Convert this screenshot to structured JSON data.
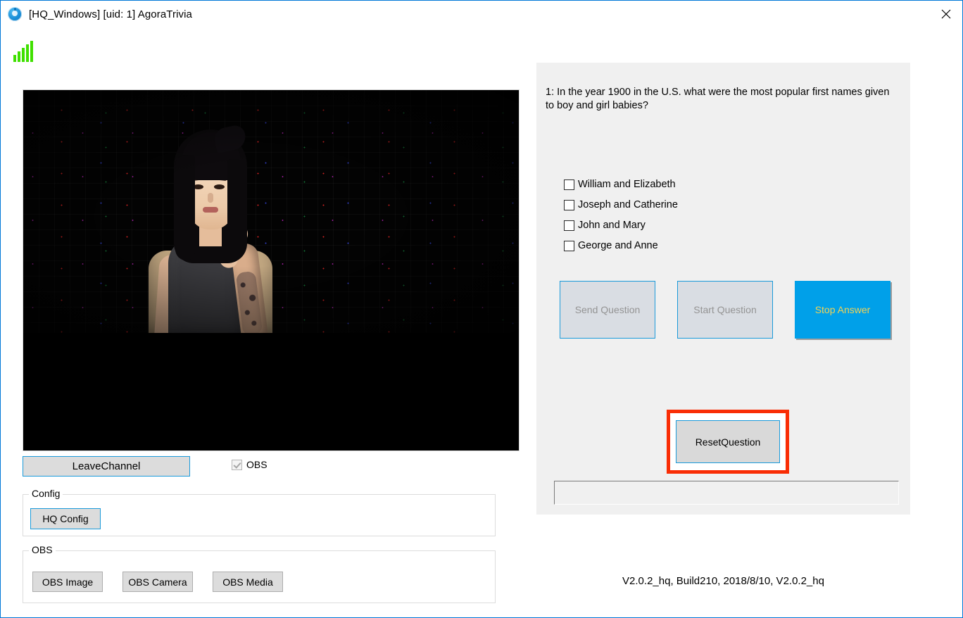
{
  "window": {
    "title": "[HQ_Windows] [uid: 1] AgoraTrivia",
    "close_label": "✕",
    "app_icon": "agora-app-icon",
    "border_color": "#0078d7"
  },
  "status": {
    "signal_icon": "signal-bars-icon",
    "signal_bars": 5,
    "signal_color": "#3fe000"
  },
  "video": {
    "name": "local-video-preview",
    "description": "Live video of a host seated in a chair against a black background with a grid of colored dots"
  },
  "left_controls": {
    "leave_channel_label": "LeaveChannel",
    "obs_checkbox_label": "OBS",
    "obs_checkbox_checked": true,
    "obs_checkbox_enabled": false,
    "config_group_label": "Config",
    "hq_config_label": "HQ Config",
    "obs_group_label": "OBS",
    "obs_buttons": [
      {
        "label": "OBS Image"
      },
      {
        "label": "OBS Camera"
      },
      {
        "label": "OBS Media"
      }
    ]
  },
  "question_panel": {
    "question": "1: In the year 1900 in the U.S. what were the most popular first names given to boy and girl babies?",
    "answers": [
      {
        "label": "William and Elizabeth",
        "checked": false
      },
      {
        "label": "Joseph and Catherine",
        "checked": false
      },
      {
        "label": "John and Mary",
        "checked": false
      },
      {
        "label": "George and Anne",
        "checked": false
      }
    ],
    "actions": [
      {
        "label": "Send Question",
        "state": "disabled"
      },
      {
        "label": "Start Question",
        "state": "disabled"
      },
      {
        "label": "Stop Answer",
        "state": "primary"
      }
    ],
    "reset_label": "ResetQuestion",
    "reset_highlight_color": "#f92d05",
    "status_value": "",
    "status_placeholder": ""
  },
  "footer": {
    "version": "V2.0.2_hq, Build210, 2018/8/10, V2.0.2_hq"
  },
  "colors": {
    "accent_blue": "#00a0e9",
    "focus_blue": "#1a9ada",
    "panel_bg": "#f0f0f0",
    "button_bg": "#dcdcdc",
    "stop_answer_text": "#f0d257"
  }
}
